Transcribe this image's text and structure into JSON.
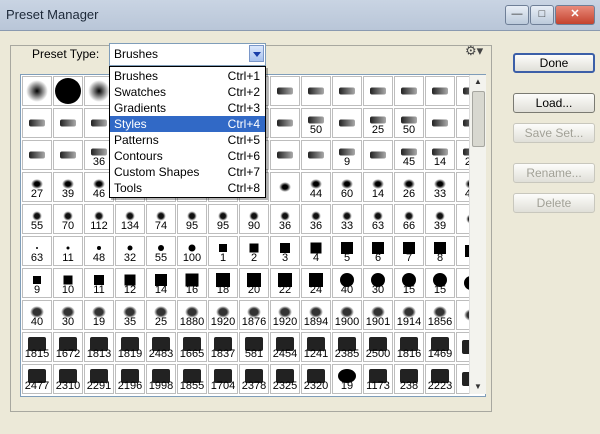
{
  "window": {
    "title": "Preset Manager",
    "minimize_icon": "minimize-icon",
    "maximize_icon": "maximize-icon",
    "close_icon": "close-icon"
  },
  "preset_type": {
    "label": "Preset Type:",
    "value": "Brushes"
  },
  "menu": {
    "items": [
      {
        "label": "Brushes",
        "shortcut": "Ctrl+1"
      },
      {
        "label": "Swatches",
        "shortcut": "Ctrl+2"
      },
      {
        "label": "Gradients",
        "shortcut": "Ctrl+3"
      },
      {
        "label": "Styles",
        "shortcut": "Ctrl+4",
        "selected": true
      },
      {
        "label": "Patterns",
        "shortcut": "Ctrl+5"
      },
      {
        "label": "Contours",
        "shortcut": "Ctrl+6"
      },
      {
        "label": "Custom Shapes",
        "shortcut": "Ctrl+7"
      },
      {
        "label": "Tools",
        "shortcut": "Ctrl+8"
      }
    ]
  },
  "buttons": {
    "done": "Done",
    "load": "Load...",
    "save_set": "Save Set...",
    "rename": "Rename...",
    "delete": "Delete"
  },
  "grid_rows": [
    [
      "",
      "",
      "",
      "",
      "",
      "",
      "",
      "",
      "",
      "",
      "",
      "",
      "",
      "",
      ""
    ],
    [
      "",
      "",
      "",
      "",
      "",
      "",
      "",
      "",
      "",
      "50",
      "",
      "25",
      "50",
      "",
      ""
    ],
    [
      "",
      "",
      "36",
      "",
      "",
      "",
      "",
      "",
      "",
      "",
      "9",
      "",
      "45",
      "14",
      "24"
    ],
    [
      "27",
      "39",
      "46",
      "",
      "",
      "",
      "",
      "",
      "",
      "44",
      "60",
      "14",
      "26",
      "33",
      "42"
    ],
    [
      "55",
      "70",
      "112",
      "134",
      "74",
      "95",
      "95",
      "90",
      "36",
      "36",
      "33",
      "63",
      "66",
      "39",
      ""
    ],
    [
      "63",
      "11",
      "48",
      "32",
      "55",
      "100",
      "1",
      "2",
      "3",
      "4",
      "5",
      "6",
      "7",
      "8",
      ""
    ],
    [
      "9",
      "10",
      "11",
      "12",
      "14",
      "16",
      "18",
      "20",
      "22",
      "24",
      "40",
      "30",
      "15",
      "15",
      ""
    ],
    [
      "40",
      "30",
      "19",
      "35",
      "25",
      "1880",
      "1920",
      "1876",
      "1920",
      "1894",
      "1900",
      "1901",
      "1914",
      "1856",
      ""
    ],
    [
      "1815",
      "1672",
      "1813",
      "1819",
      "2483",
      "1665",
      "1837",
      "581",
      "2454",
      "1241",
      "2385",
      "2500",
      "1816",
      "1469",
      ""
    ],
    [
      "2477",
      "2310",
      "2291",
      "2196",
      "1998",
      "1855",
      "1704",
      "2378",
      "2325",
      "2320",
      "19",
      "1173",
      "238",
      "2223",
      ""
    ]
  ],
  "settings_icon": "gear-icon"
}
